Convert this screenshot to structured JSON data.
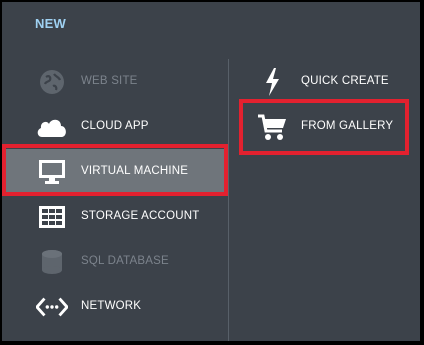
{
  "header": {
    "title": "NEW"
  },
  "left_menu": {
    "items": [
      {
        "label": "WEB SITE",
        "icon": "globe-icon",
        "state": "disabled"
      },
      {
        "label": "CLOUD APP",
        "icon": "cloud-icon",
        "state": "normal"
      },
      {
        "label": "VIRTUAL MACHINE",
        "icon": "monitor-icon",
        "state": "selected"
      },
      {
        "label": "STORAGE ACCOUNT",
        "icon": "table-icon",
        "state": "normal"
      },
      {
        "label": "SQL DATABASE",
        "icon": "database-icon",
        "state": "disabled"
      },
      {
        "label": "NETWORK",
        "icon": "network-icon",
        "state": "normal"
      }
    ]
  },
  "right_menu": {
    "items": [
      {
        "label": "QUICK CREATE",
        "icon": "lightning-icon"
      },
      {
        "label": "FROM GALLERY",
        "icon": "shopping-cart-icon"
      }
    ]
  },
  "colors": {
    "panel_background": "#3c424a",
    "title": "#9fd1f2",
    "selected_background": "#6f757b",
    "highlight_border": "#e3212f",
    "disabled_text": "#7c838c"
  }
}
